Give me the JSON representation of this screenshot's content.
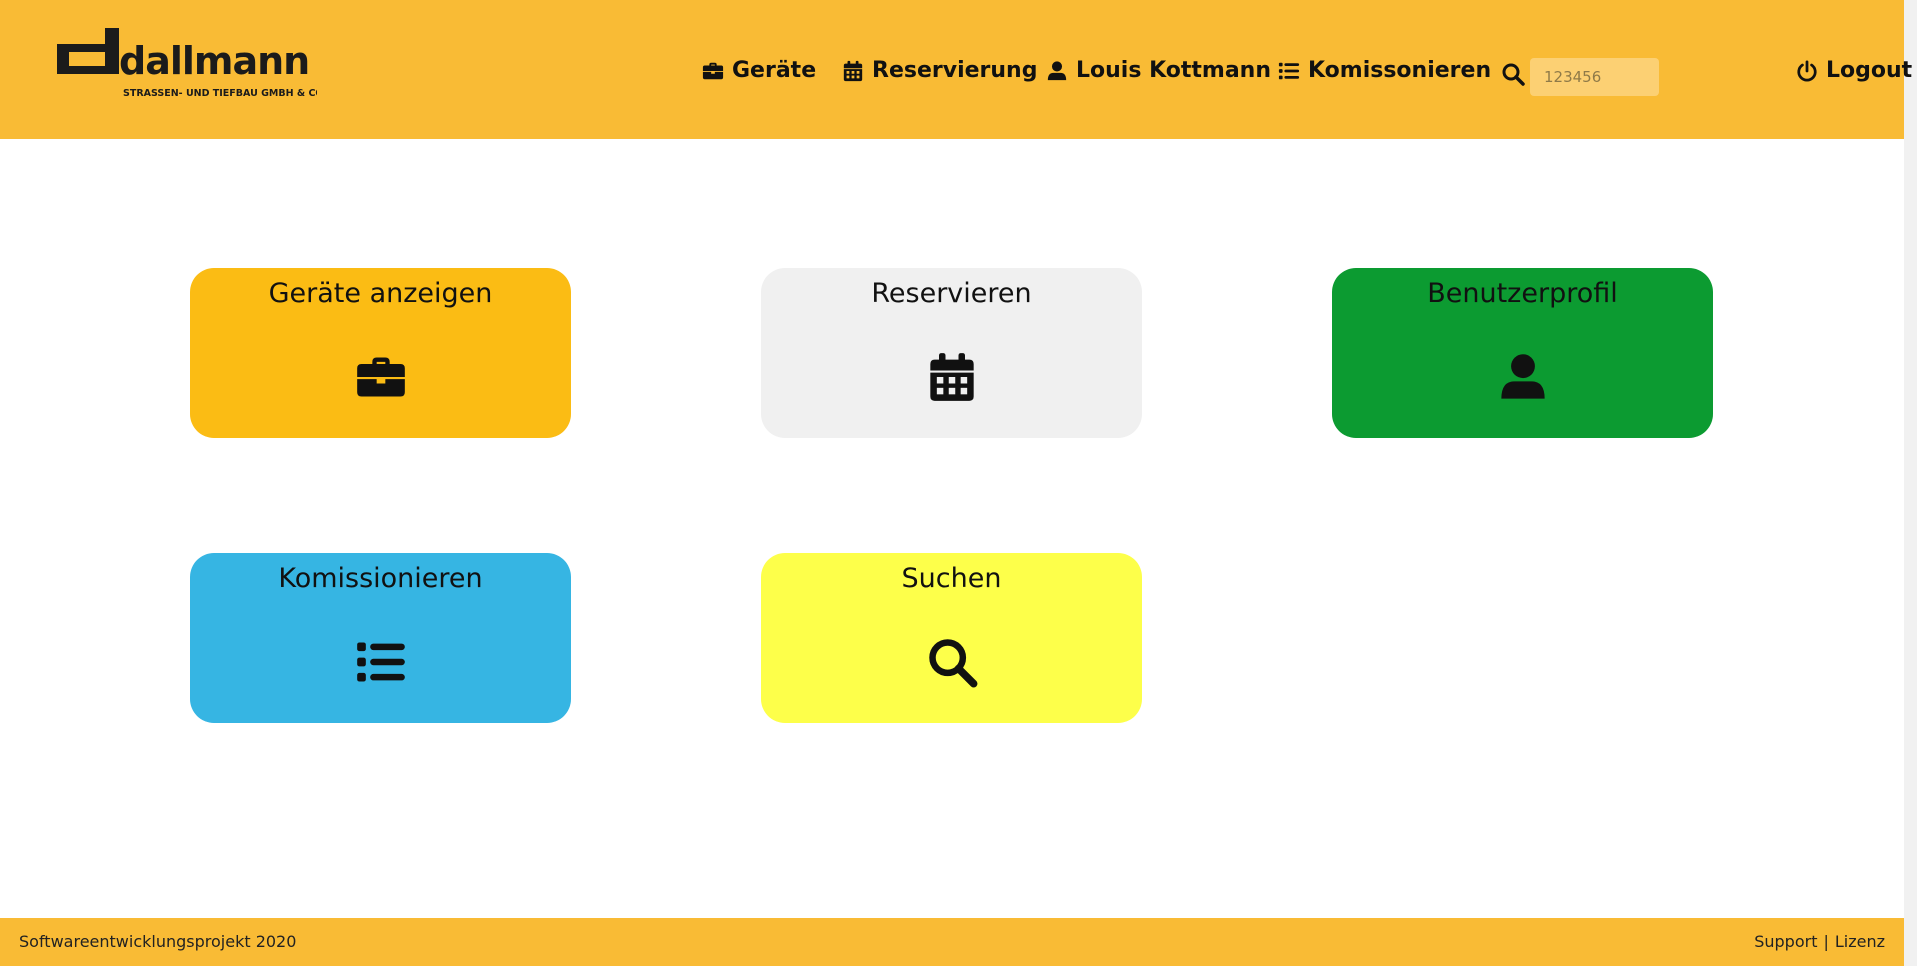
{
  "header": {
    "logo": {
      "brand": "dallmann",
      "tagline": "STRASSEN- UND TIEFBAU GMBH & CO.KG"
    },
    "nav": {
      "geraete": "Geräte",
      "reservierung": "Reservierung",
      "user": "Louis Kottmann",
      "komissionieren": "Komissonieren",
      "search_placeholder": "123456",
      "logout": "Logout"
    }
  },
  "tiles": {
    "geraete": {
      "title": "Geräte anzeigen",
      "icon": "briefcase-icon",
      "color": "#fbbc14"
    },
    "reservieren": {
      "title": "Reservieren",
      "icon": "calendar-icon",
      "color": "#f0f0f0"
    },
    "profil": {
      "title": "Benutzerprofil",
      "icon": "user-icon",
      "color": "#0c9b31"
    },
    "kommissionieren": {
      "title": "Komissionieren",
      "icon": "list-icon",
      "color": "#36b5e3"
    },
    "suchen": {
      "title": "Suchen",
      "icon": "search-icon",
      "color": "#fdff4a"
    }
  },
  "footer": {
    "left": "Softwareentwicklungsprojekt 2020",
    "support": "Support",
    "separator": "|",
    "lizenz": "Lizenz"
  },
  "colors": {
    "header_bg": "#f9bb35",
    "text": "#111111"
  }
}
